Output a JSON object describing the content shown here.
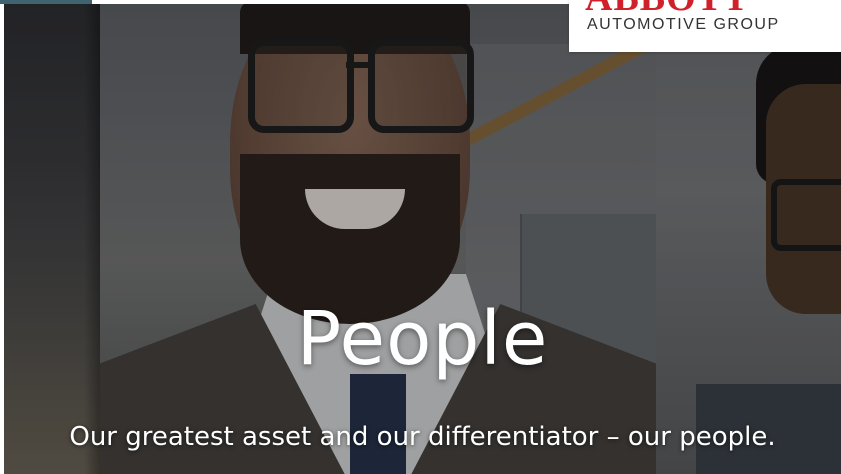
{
  "logo": {
    "brand": "ABBOTT",
    "subtitle": "AUTOMOTIVE GROUP"
  },
  "hero": {
    "title": "People",
    "tagline": "Our greatest asset and our differentiator – our people."
  },
  "colors": {
    "brand_red": "#d0212a",
    "text_white": "#ffffff"
  }
}
